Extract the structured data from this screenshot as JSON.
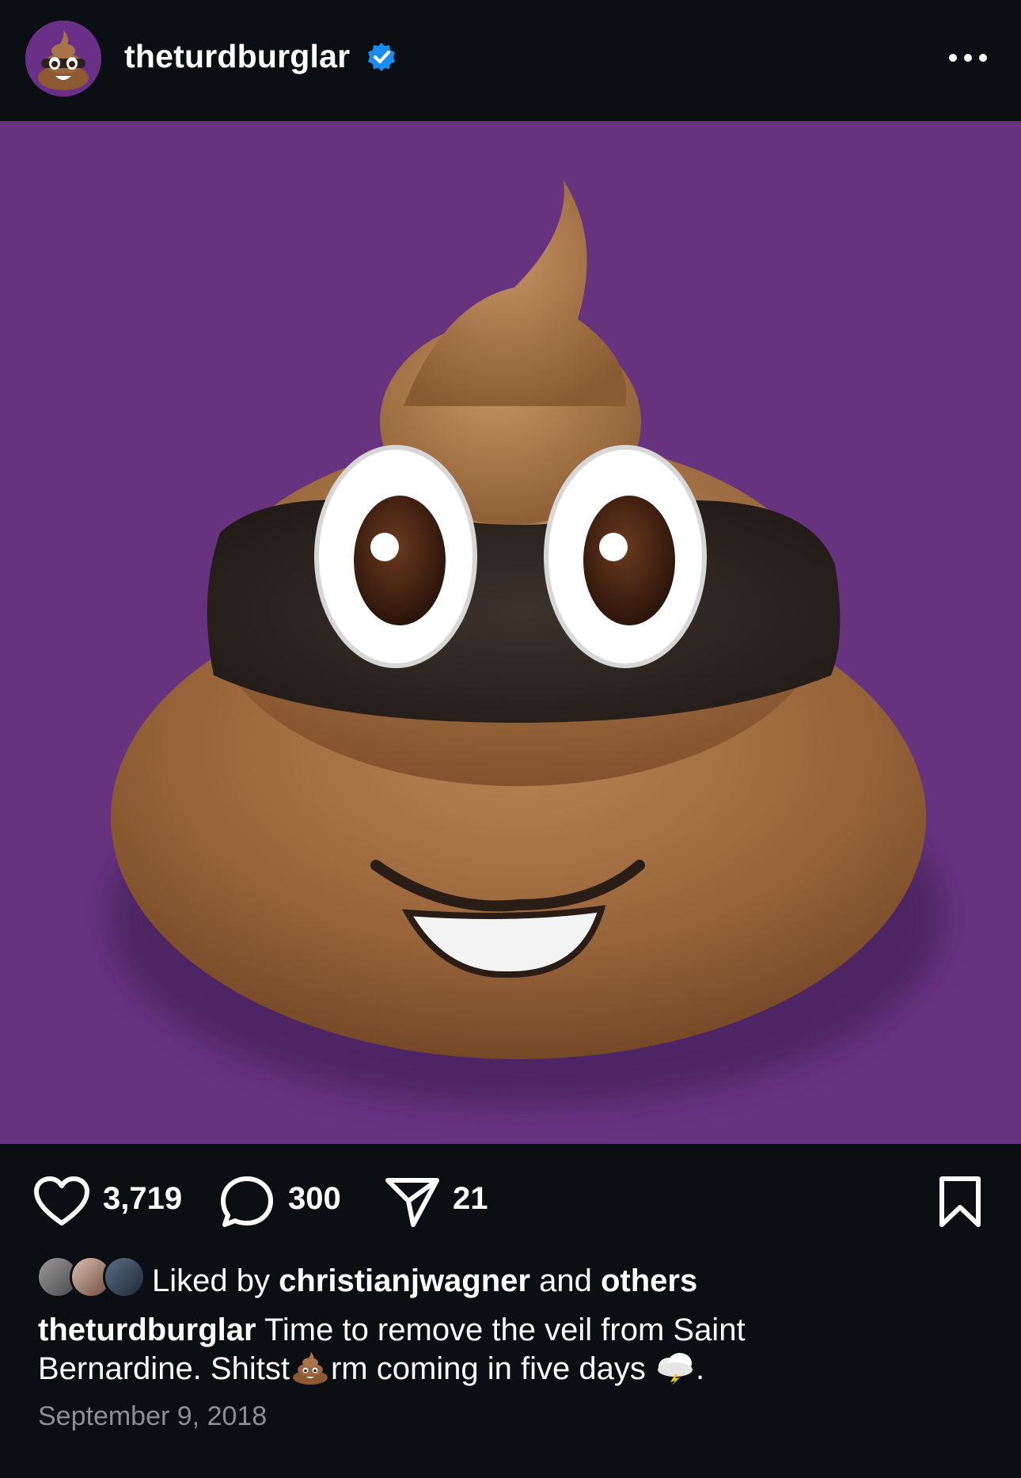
{
  "post": {
    "username": "theturdburglar",
    "verified_icon": "verified-badge-icon",
    "more_icon": "more-options-icon",
    "counts": {
      "likes": "3,719",
      "comments": "300",
      "shares": "21"
    },
    "liked_by": {
      "prefix": "Liked by",
      "user": "christianjwagner",
      "connector": "and",
      "others": "others"
    },
    "caption": {
      "username": "theturdburglar",
      "text_1": "Time to remove the veil from Saint",
      "text_2": "Bernardine. Shitst",
      "text_3": "rm coming in five days",
      "text_4": "."
    },
    "date": "September 9, 2018"
  },
  "colors": {
    "background": "#0b0e13",
    "photo_background": "#67337f",
    "verified_blue": "#1a8cf0",
    "muted_text": "#8c9096"
  }
}
